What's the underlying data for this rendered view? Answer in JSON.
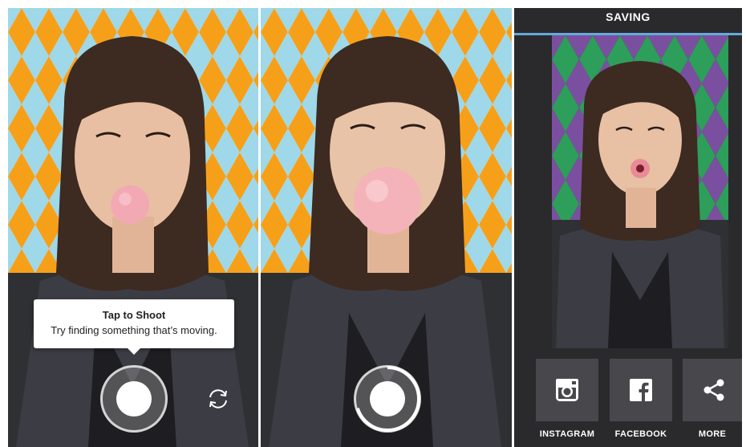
{
  "panel1": {
    "tooltip": {
      "title": "Tap to Shoot",
      "text": "Try finding something that’s moving."
    }
  },
  "panel2": {
    "recording_progress": 0.7
  },
  "panel3": {
    "title": "SAVING",
    "saving_progress": 1.0,
    "share_buttons": [
      {
        "label": "INSTAGRAM",
        "icon": "instagram-icon"
      },
      {
        "label": "FACEBOOK",
        "icon": "facebook-icon"
      },
      {
        "label": "MORE",
        "icon": "share-icon"
      }
    ]
  },
  "colors": {
    "accent": "#63a9dc",
    "dark_bg": "#2a2a2c",
    "share_tile": "#48484c",
    "gum": "#f2a9b4"
  }
}
